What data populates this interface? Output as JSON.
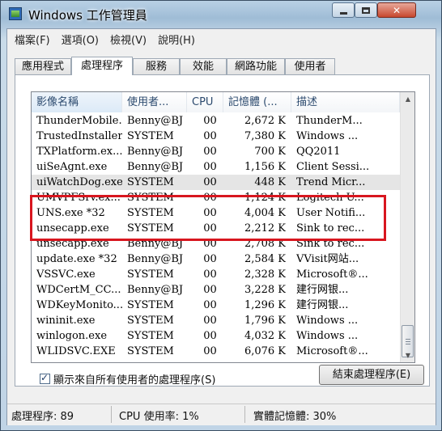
{
  "window": {
    "title": "Windows 工作管理員"
  },
  "menu": [
    "檔案(F)",
    "選項(O)",
    "檢視(V)",
    "說明(H)"
  ],
  "tabs": [
    "應用程式",
    "處理程序",
    "服務",
    "效能",
    "網路功能",
    "使用者"
  ],
  "active_tab": "處理程序",
  "table": {
    "columns": [
      "影像名稱",
      "使用者...",
      "CPU",
      "記憶體 (...",
      "描述"
    ],
    "rows": [
      [
        "ThunderMobile...",
        "Benny@BJ",
        "00",
        "2,672 K",
        "ThunderM..."
      ],
      [
        "TrustedInstaller...",
        "SYSTEM",
        "00",
        "7,380 K",
        "Windows ..."
      ],
      [
        "TXPlatform.ex...",
        "Benny@BJ",
        "00",
        "700 K",
        "QQ2011"
      ],
      [
        "uiSeAgnt.exe",
        "Benny@BJ",
        "00",
        "1,156 K",
        "Client Sessi..."
      ],
      [
        "uiWatchDog.exe",
        "SYSTEM",
        "00",
        "448 K",
        "Trend Micr..."
      ],
      [
        "UMVPFSrv.ex...",
        "SYSTEM",
        "00",
        "1,124 K",
        "Logitech U..."
      ],
      [
        "UNS.exe *32",
        "SYSTEM",
        "00",
        "4,004 K",
        "User Notifi..."
      ],
      [
        "unsecapp.exe",
        "SYSTEM",
        "00",
        "2,212 K",
        "Sink to rec..."
      ],
      [
        "unsecapp.exe",
        "Benny@BJ",
        "00",
        "2,708 K",
        "Sink to rec..."
      ],
      [
        "update.exe *32",
        "Benny@BJ",
        "00",
        "2,584 K",
        "VVisit网站..."
      ],
      [
        "VSSVC.exe",
        "SYSTEM",
        "00",
        "2,328 K",
        "Microsoft®..."
      ],
      [
        "WDCertM_CC...",
        "Benny@BJ",
        "00",
        "3,228 K",
        "建行网银..."
      ],
      [
        "WDKeyMonito...",
        "SYSTEM",
        "00",
        "1,296 K",
        "建行网银..."
      ],
      [
        "wininit.exe",
        "SYSTEM",
        "00",
        "1,796 K",
        "Windows ..."
      ],
      [
        "winlogon.exe",
        "SYSTEM",
        "00",
        "4,032 K",
        "Windows ..."
      ],
      [
        "WLIDSVC.EXE",
        "SYSTEM",
        "00",
        "6,076 K",
        "Microsoft®..."
      ]
    ],
    "highlighted_rows": [
      "uiSeAgnt.exe",
      "uiWatchDog.exe"
    ]
  },
  "show_all_checkbox": {
    "label": "顯示來自所有使用者的處理程序(S)",
    "checked": true
  },
  "end_process_button": "結束處理程序(E)",
  "status": {
    "processes": "處理程序: 89",
    "cpu": "CPU 使用率: 1%",
    "memory": "實體記憶體: 30%"
  },
  "colors": {
    "annotation_box": "#d8161f",
    "titlebar": "#b9d1e5"
  }
}
